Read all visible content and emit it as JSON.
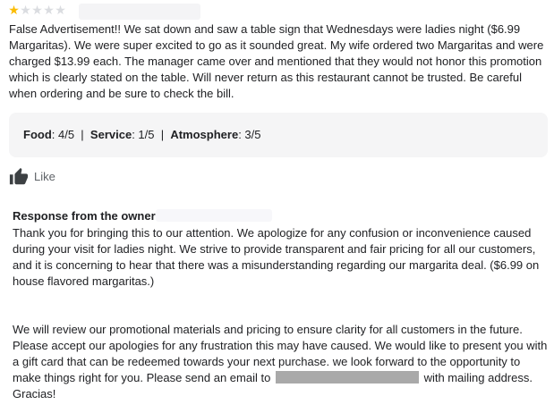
{
  "review": {
    "rating": 1,
    "max_rating": 5,
    "text": "False Advertisement!! We sat down and saw a table sign that Wednesdays were ladies night ($6.99 Margaritas). We were super excited to go as it sounded great. My wife ordered two Margaritas and were charged $13.99 each. The manager came over and mentioned that they would not honor this promotion which is clearly stated on the table. Will never return as this restaurant cannot be trusted. Be careful when ordering and be sure to check the bill.",
    "ratings": {
      "food_label": "Food",
      "food_value": ": 4/5",
      "service_label": "Service",
      "service_value": ": 1/5",
      "atmosphere_label": "Atmosphere",
      "atmosphere_value": ": 3/5",
      "separator": "|"
    },
    "like_label": "Like"
  },
  "owner_response": {
    "title": "Response from the owner",
    "paragraph1": "Thank you for bringing this to our attention. We apologize for any confusion or inconvenience caused during your visit for ladies night. We strive to provide transparent and fair pricing for all our customers, and it is concerning to hear that there was a misunderstanding regarding our margarita deal. ($6.99 on house flavored margaritas.)",
    "paragraph2_before": "We will review our promotional materials and pricing to ensure clarity for all customers in the future. Please accept our apologies for any frustration this may have caused. We would like to present you with a gift card that can be redeemed towards your next purchase. we look forward to the opportunity to make things right for you. Please send an email to",
    "paragraph2_after": "with mailing address. Gracias!"
  },
  "colors": {
    "star_filled": "#fbbc04",
    "star_empty": "#dadce0",
    "ratings_bg": "#f5f5f6",
    "redaction": "#a9a9a9"
  },
  "icons": {
    "star": "star-icon",
    "like": "thumbs-up-icon"
  }
}
